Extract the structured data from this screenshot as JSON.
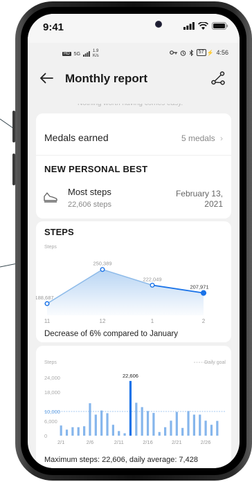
{
  "ios_status": {
    "time": "9:41"
  },
  "android_status": {
    "speed_value": "1.9",
    "speed_unit": "K/s",
    "battery": "57",
    "time": "4:56",
    "network": "5G"
  },
  "header": {
    "title": "Monthly report"
  },
  "cut_text": "Nothing worth having comes easy.",
  "medals": {
    "label": "Medals earned",
    "value": "5 medals"
  },
  "personal_best": {
    "heading": "NEW PERSONAL BEST",
    "name": "Most steps",
    "steps": "22,606 steps",
    "date": "February 13, 2021"
  },
  "steps_card": {
    "heading": "STEPS",
    "sub_label": "Steps",
    "comparison_text": "Decrease of 6% compared to January"
  },
  "daily_card": {
    "steps_label": "Steps",
    "legend_label": "Daily goal",
    "summary_text": "Maximum steps: 22,606, daily average: 7,428"
  },
  "colors": {
    "accent": "#1a73e8",
    "bar": "#86b6ec",
    "line": "#4a90d9"
  },
  "chart_data": [
    {
      "type": "line",
      "ylabel": "Steps",
      "categories": [
        "11",
        "12",
        "1",
        "2"
      ],
      "values": [
        188687,
        250389,
        222049,
        207971
      ],
      "data_labels": [
        "188,687",
        "250,389",
        "222,049",
        "207,971"
      ],
      "highlight_index": 3
    },
    {
      "type": "bar",
      "ylabel": "Steps",
      "legend": "Daily goal",
      "ylim": [
        0,
        24000
      ],
      "y_ticks": [
        "0",
        "6,000",
        "10,000",
        "18,000",
        "24,000"
      ],
      "y_tick_values": [
        0,
        6000,
        10000,
        18000,
        24000
      ],
      "goal": 10000,
      "x_tick_labels": [
        "2/1",
        "2/6",
        "2/11",
        "2/16",
        "2/21",
        "2/26"
      ],
      "x_tick_days": [
        1,
        6,
        11,
        16,
        21,
        26
      ],
      "days": [
        1,
        2,
        3,
        4,
        5,
        6,
        7,
        8,
        9,
        10,
        11,
        12,
        13,
        14,
        15,
        16,
        17,
        18,
        19,
        20,
        21,
        22,
        23,
        24,
        25,
        26,
        27,
        28
      ],
      "values": [
        4200,
        2500,
        3500,
        3500,
        3900,
        13400,
        8700,
        10400,
        9300,
        4500,
        1900,
        1000,
        22606,
        13600,
        11800,
        10200,
        9400,
        1500,
        3500,
        6200,
        9800,
        3200,
        10200,
        8700,
        8700,
        6200,
        4500,
        6100
      ],
      "highlight_label": "22,606",
      "highlight_index": 12
    }
  ]
}
